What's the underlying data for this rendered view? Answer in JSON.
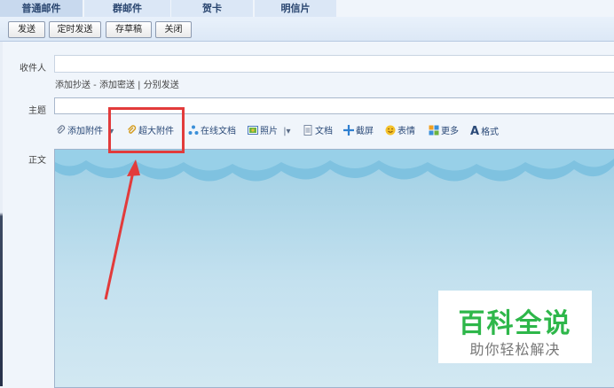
{
  "tabs": [
    "普通邮件",
    "群邮件",
    "贺卡",
    "明信片"
  ],
  "toolbar": {
    "send": "发送",
    "schedule": "定时发送",
    "draft": "存草稿",
    "close": "关闭"
  },
  "form": {
    "recipient_label": "收件人",
    "recipient_links": "添加抄送 - 添加密送 | 分别发送",
    "subject_label": "主题",
    "body_label": "正文"
  },
  "attachments": [
    {
      "label": "添加附件",
      "icon": "paperclip-icon"
    },
    {
      "label": "超大附件",
      "icon": "paperclip-icon"
    },
    {
      "label": "在线文档",
      "icon": "share-icon"
    },
    {
      "label": "照片",
      "icon": "photo-icon"
    },
    {
      "label": "文档",
      "icon": "document-icon"
    },
    {
      "label": "截屏",
      "icon": "screenshot-icon"
    },
    {
      "label": "表情",
      "icon": "smiley-icon"
    },
    {
      "label": "更多",
      "icon": "grid-icon"
    },
    {
      "label": "格式",
      "icon": "font-icon"
    }
  ],
  "watermark": {
    "title": "百科全说",
    "subtitle": "助你轻松解决"
  },
  "colors": {
    "highlight": "#e23b3b",
    "watermark_green": "#2eb74a"
  }
}
